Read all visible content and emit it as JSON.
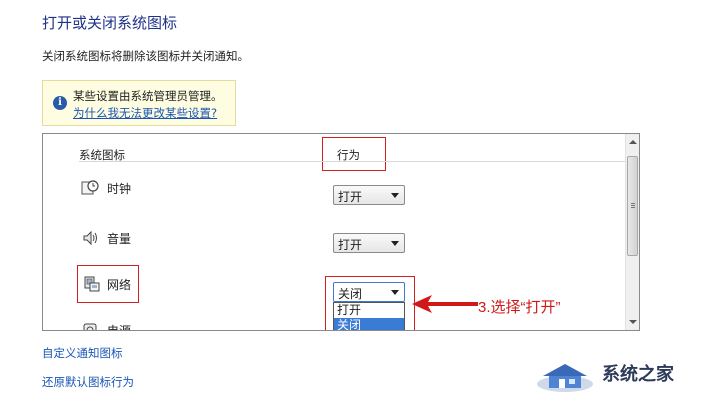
{
  "header": {
    "title": "打开或关闭系统图标",
    "subtitle": "关闭系统图标将删除该图标并关闭通知。"
  },
  "info_box": {
    "icon": "info-icon",
    "message": "某些设置由系统管理员管理。",
    "link": "为什么我无法更改某些设置?"
  },
  "table": {
    "columns": [
      "系统图标",
      "行为"
    ],
    "rows": [
      {
        "icon": "clock-icon",
        "label": "时钟",
        "value": "打开"
      },
      {
        "icon": "speaker-icon",
        "label": "音量",
        "value": "打开"
      },
      {
        "icon": "network-icon",
        "label": "网络",
        "value": "关闭"
      },
      {
        "icon": "power-icon",
        "label": "电源",
        "value": ""
      }
    ],
    "dropdown_options": [
      "打开",
      "关闭"
    ],
    "highlighted_option": "关闭"
  },
  "annotation": {
    "text": "3.选择“打开”",
    "color": "#d01818"
  },
  "links": {
    "customize": "自定义通知图标",
    "restore": "还原默认图标行为"
  },
  "watermark": {
    "brand": "系统之家"
  }
}
